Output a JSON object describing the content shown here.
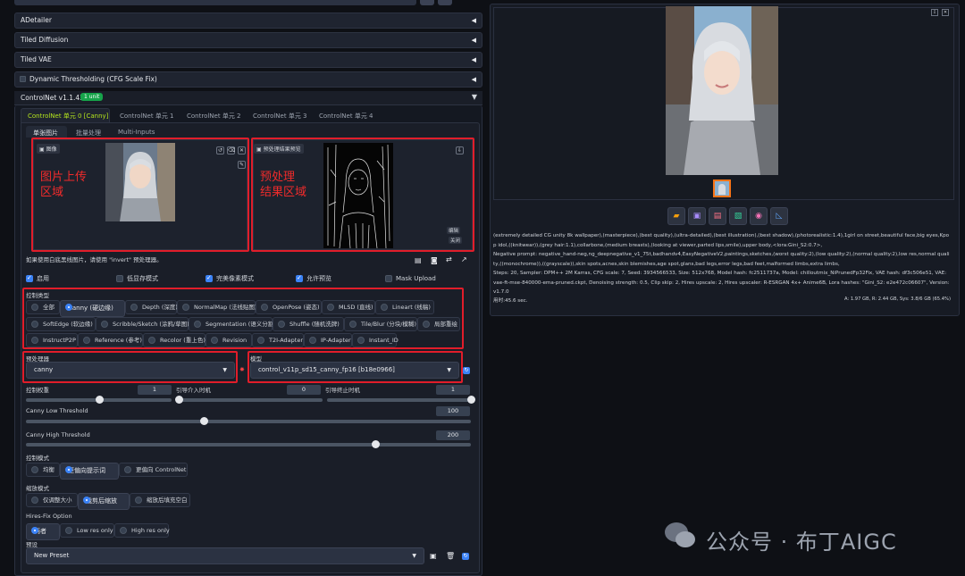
{
  "accordions": [
    {
      "label": "ADetailer"
    },
    {
      "label": "Tiled Diffusion"
    },
    {
      "label": "Tiled VAE"
    },
    {
      "label": "Dynamic Thresholding (CFG Scale Fix)"
    }
  ],
  "controlnet": {
    "title": "ControlNet v1.1.439",
    "badge": "1 unit",
    "unit_tabs": [
      "ControlNet 单元 0 [Canny]",
      "ControlNet 单元 1",
      "ControlNet 单元 2",
      "ControlNet 单元 3",
      "ControlNet 单元 4"
    ],
    "input_tabs": [
      "单张图片",
      "批量处理",
      "Multi-Inputs"
    ],
    "image_label": "图像",
    "preview_label": "预处理结果预览",
    "annotation_upload": "图片上传\n区域",
    "annotation_preview": "预处理\n结果区域",
    "edit_btn": "编辑",
    "close_btn": "关闭",
    "hint": "如果使用白底黑线图片，请使用 \"invert\" 预处理器。",
    "checks": [
      {
        "label": "启用",
        "checked": true
      },
      {
        "label": "低显存模式",
        "checked": false
      },
      {
        "label": "完美像素模式",
        "checked": true
      },
      {
        "label": "允许预览",
        "checked": true
      },
      {
        "label": "Mask Upload",
        "checked": false
      }
    ],
    "control_type_label": "控制类型",
    "control_types": [
      "全部",
      "Canny (硬边缘)",
      "Depth (深度)",
      "NormalMap (法线贴图)",
      "OpenPose (姿态)",
      "MLSD (直线)",
      "Lineart (线稿)",
      "SoftEdge (软边缘)",
      "Scribble/Sketch (涂鸦/草图)",
      "Segmentation (语义分割)",
      "Shuffle (随机洗牌)",
      "Tile/Blur (分块/模糊)",
      "局部重绘",
      "InstructP2P",
      "Reference (参考)",
      "Recolor (重上色)",
      "Revision",
      "T2I-Adapter",
      "IP-Adapter",
      "Instant_ID"
    ],
    "control_type_selected": "Canny (硬边缘)",
    "preprocessor_label": "预处理器",
    "preprocessor_value": "canny",
    "model_label": "模型",
    "model_value": "control_v11p_sd15_canny_fp16 [b18e0966]",
    "weight_label": "控制权重",
    "weight_value": "1",
    "start_label": "引导介入时机",
    "start_value": "0",
    "end_label": "引导终止时机",
    "end_value": "1",
    "low_label": "Canny Low Threshold",
    "low_value": "100",
    "high_label": "Canny High Threshold",
    "high_value": "200",
    "mode_label": "控制模式",
    "modes": [
      "均衡",
      "更偏向提示词",
      "更偏向 ControlNet"
    ],
    "mode_selected": "更偏向提示词",
    "resize_label": "缩放模式",
    "resizes": [
      "仅调整大小",
      "裁剪后缩放",
      "缩放后填充空白"
    ],
    "resize_selected": "裁剪后缩放",
    "hires_label": "Hires-Fix Option",
    "hires": [
      "两者",
      "Low res only",
      "High res only"
    ],
    "hires_selected": "两者",
    "preset_label": "预设",
    "preset_value": "New Preset"
  },
  "output": {
    "prompt": "(extremely detailed CG unity 8k wallpaper),(masterpiece),(best quality),(ultra-detailed),(best illustration),(best shadow),(photorealistic:1.4),1girl on street,beautiful face,big eyes,Kpop idol,((knitwear)),(grey hair:1.1),collarbone,(medium breasts),(looking at viewer,parted lips,smile),upper body,<lora:Gini_S2:0.7>,",
    "negative": "Negative prompt: negative_hand-neg,ng_deepnegative_v1_75t,badhandv4,EasyNegativeV2,paintings,sketches,(worst quality:2),(low quality:2),(normal quality:2),low res,normal quality,((monochrome)),((grayscale)),skin spots,acnes,skin blemishes,age spot,glans,bad legs,error legs,bad feet,malformed limbs,extra limbs,",
    "params": "Steps: 20, Sampler: DPM++ 2M Karras, CFG scale: 7, Seed: 3934566533, Size: 512x768, Model hash: fc2511737a, Model: chilloutmix_NiPrunedFp32Fix, VAE hash: df3c506e51, VAE: vae-ft-mse-840000-ema-pruned.ckpt, Denoising strength: 0.5, Clip skip: 2, Hires upscale: 2, Hires upscaler: R-ESRGAN 4x+ Anime6B, Lora hashes: \"Gini_S2: e2e472c06607\", Version: v1.7.0",
    "time": "用时:45.6 sec.",
    "vram": "A: 1.97 GB, R: 2.44 GB, Sys: 3.8/6 GB (65.4%)"
  },
  "watermark": "公众号 · 布丁AIGC"
}
